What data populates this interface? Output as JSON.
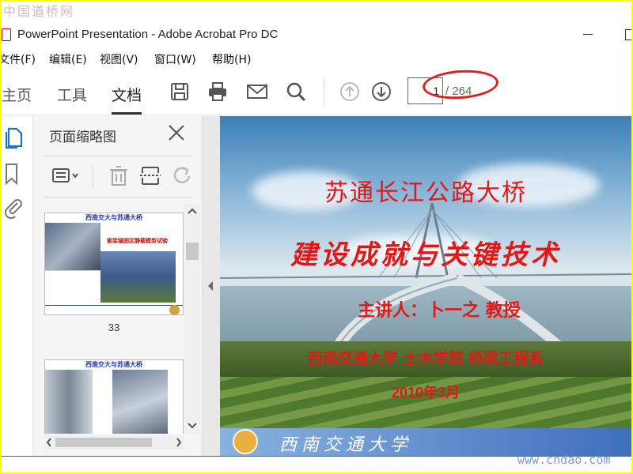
{
  "watermark_top": "中国道桥网",
  "watermark_bottom": "www.cndao.com",
  "window": {
    "title": "PowerPoint Presentation - Adobe Acrobat Pro DC"
  },
  "menu": [
    "文件(F)",
    "编辑(E)",
    "视图(V)",
    "窗口(W)",
    "帮助(H)"
  ],
  "nav_tabs": [
    {
      "label": "主页",
      "active": false
    },
    {
      "label": "工具",
      "active": false
    },
    {
      "label": "文档",
      "active": true
    }
  ],
  "toolbar": {
    "icons": [
      "save-icon",
      "print-icon",
      "email-icon",
      "search-icon",
      "page-up-icon",
      "page-down-icon"
    ],
    "page_current": "1",
    "page_total": "/ 264",
    "highlight_color": "#e02020"
  },
  "left_rail": [
    "page-thumbnails-icon",
    "bookmark-icon",
    "attachment-icon"
  ],
  "panel": {
    "title": "页面缩略图",
    "tools": [
      "page-options-icon",
      "delete-icon",
      "extract-icon",
      "rotate-icon"
    ],
    "thumbnails": [
      {
        "page": "33",
        "header": "西南交大与苏通大桥",
        "note": "索梁锚固区静载模型试验"
      },
      {
        "page": "",
        "header": "西南交大与苏通大桥",
        "note": ""
      }
    ]
  },
  "slide": {
    "title1": "苏通长江公路大桥",
    "title2": "建设成就与关键技术",
    "speaker": "主讲人：卜一之 教授",
    "affiliation": "西南交通大学 土木学院 桥梁工程系",
    "date": "2010年3月",
    "footer": "西南交通大学",
    "text_color": "#e01818"
  }
}
